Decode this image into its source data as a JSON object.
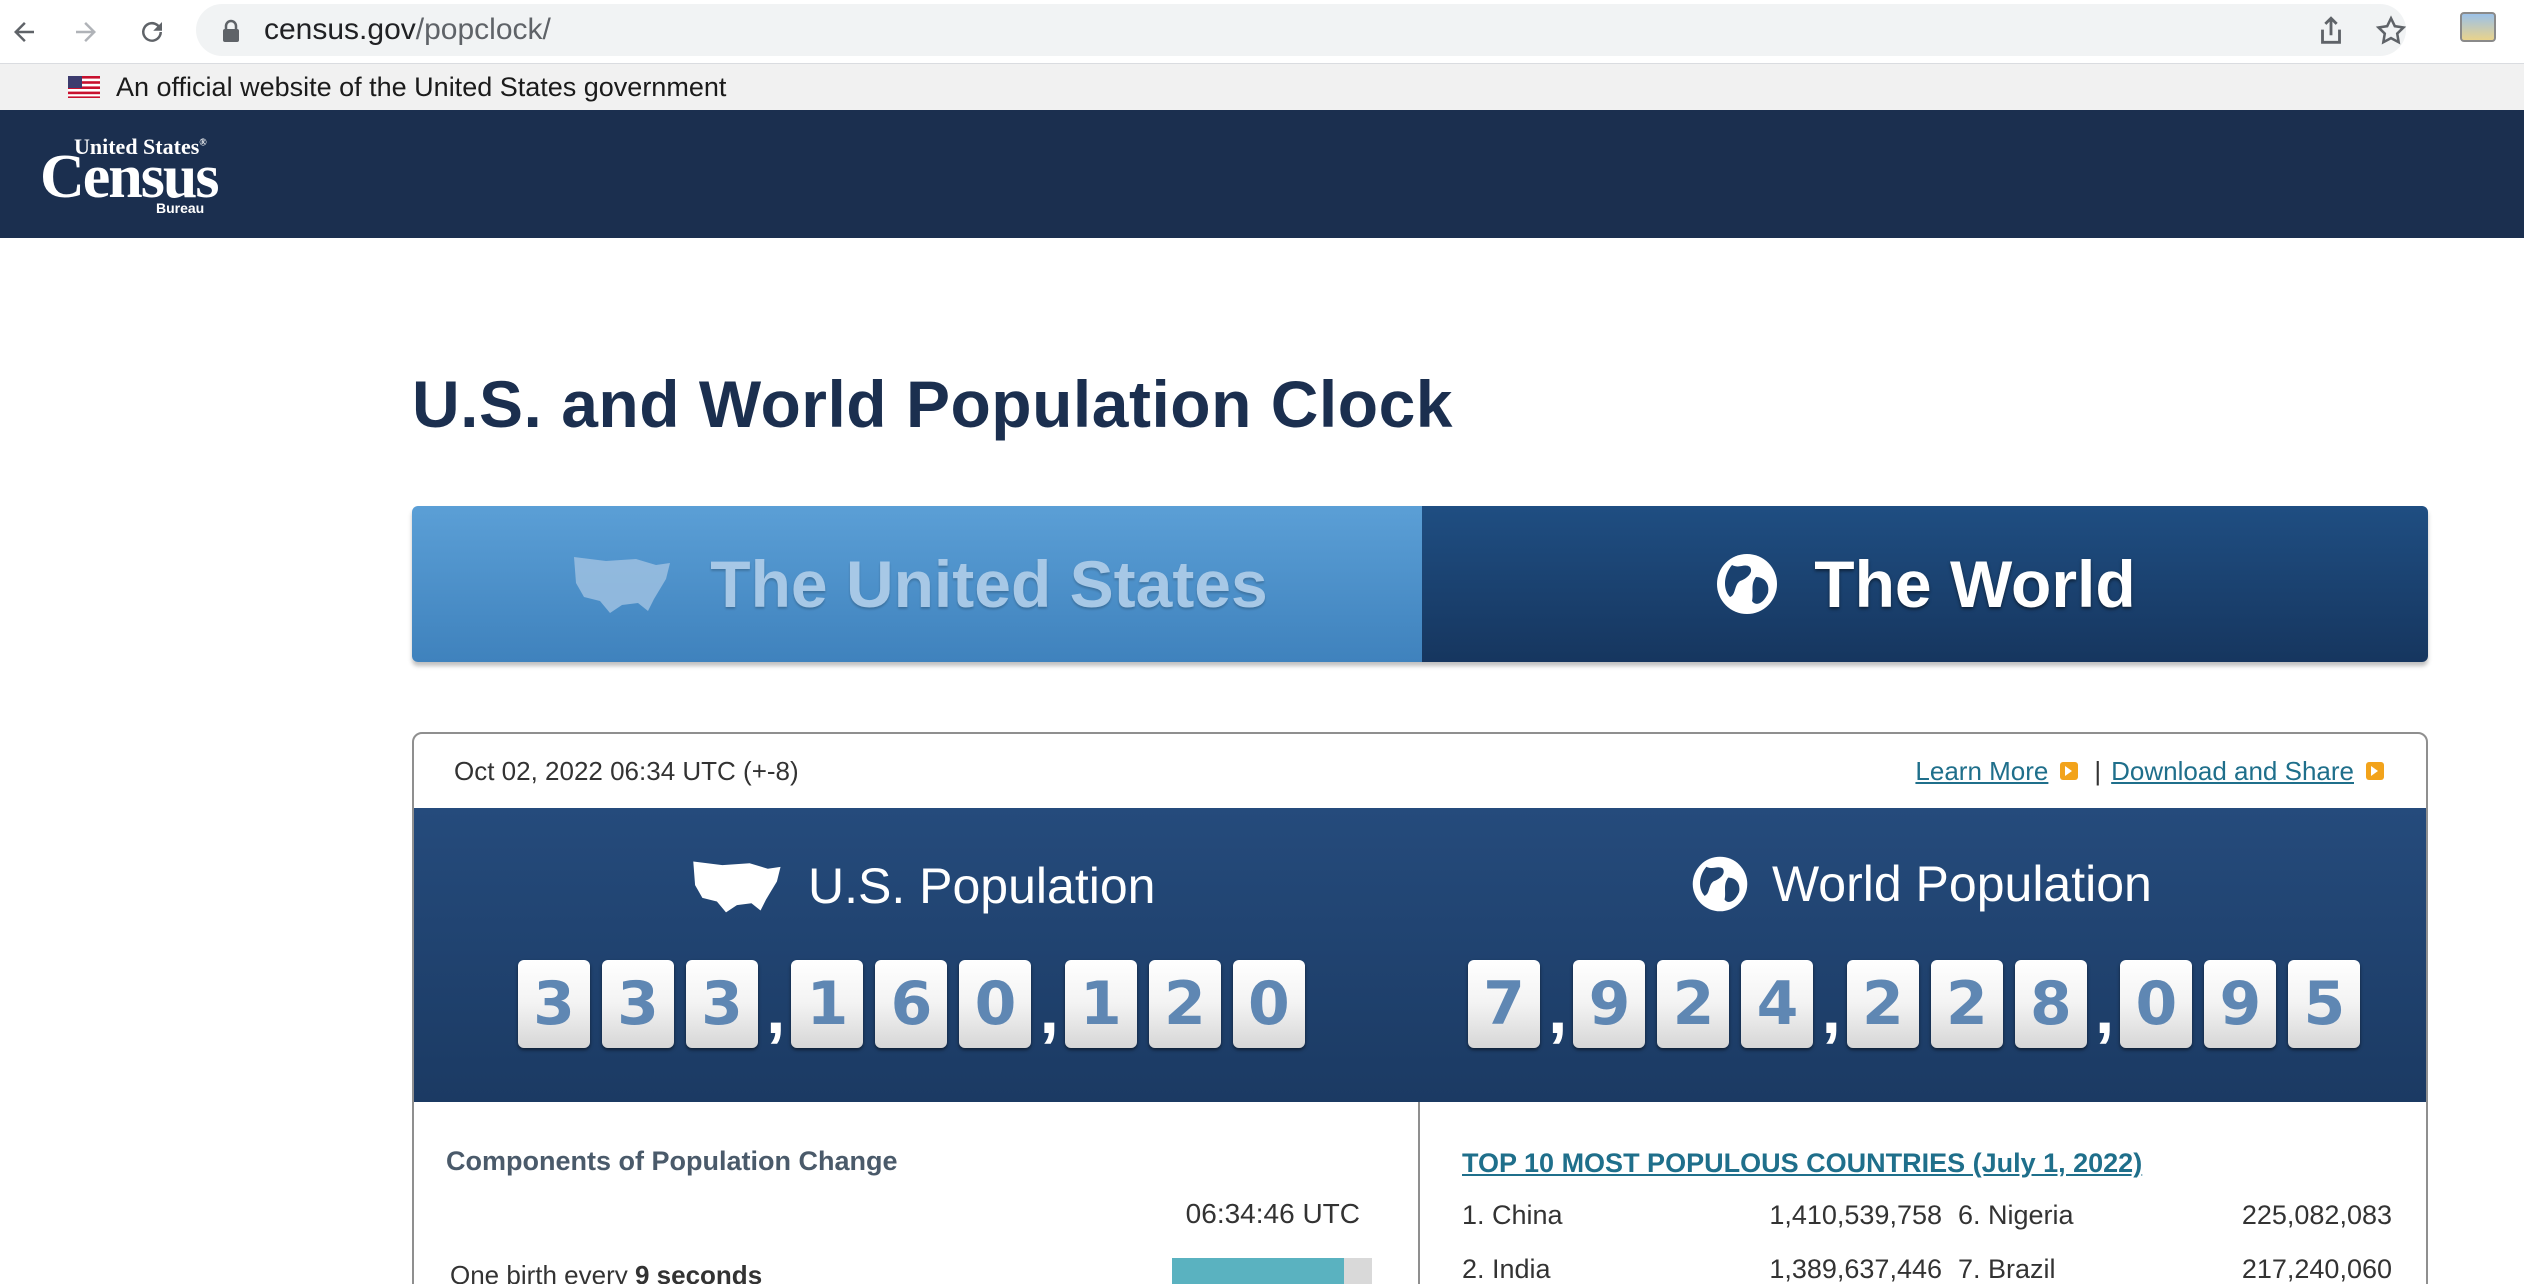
{
  "browser": {
    "url_host": "census.gov",
    "url_path": "/popclock/"
  },
  "gov_banner": {
    "text": "An official website of the United States government"
  },
  "logo": {
    "line1": "United States",
    "line2": "Census",
    "line3": "Bureau"
  },
  "page": {
    "title": "U.S. and World Population Clock"
  },
  "tabs": [
    {
      "label": "The United States",
      "active": false
    },
    {
      "label": "The World",
      "active": true
    }
  ],
  "panel": {
    "timestamp": "Oct 02, 2022 06:34 UTC (+-8)",
    "learn_more": "Learn More",
    "separator": "|",
    "download_share": "Download and Share"
  },
  "us_population": {
    "label": "U.S. Population",
    "digit_groups": [
      [
        "3",
        "3",
        "3"
      ],
      [
        "1",
        "6",
        "0"
      ],
      [
        "1",
        "2",
        "0"
      ]
    ],
    "value": "333,160,120"
  },
  "world_population": {
    "label": "World Population",
    "digit_groups": [
      [
        "7"
      ],
      [
        "9",
        "2",
        "4"
      ],
      [
        "2",
        "2",
        "8"
      ],
      [
        "0",
        "9",
        "5"
      ]
    ],
    "value": "7,924,228,095"
  },
  "components": {
    "title": "Components of Population Change",
    "time": "06:34:46 UTC",
    "birth_prefix": "One birth every ",
    "birth_seconds": "9 seconds",
    "birth_progress": 0.86
  },
  "top10": {
    "title": "TOP 10 MOST POPULOUS COUNTRIES (July 1, 2022)",
    "rows": [
      {
        "left_country": "1. China",
        "left_value": "1,410,539,758",
        "right_country": "6. Nigeria",
        "right_value": "225,082,083"
      },
      {
        "left_country": "2. India",
        "left_value": "1,389,637,446",
        "right_country": "7. Brazil",
        "right_value": "217,240,060"
      }
    ]
  },
  "colors": {
    "header_navy": "#1b2f4f",
    "tab_us": "#4a8fca",
    "tab_world": "#1a416f",
    "counter_band": "#214470",
    "link_teal": "#1f6f8b",
    "accent_orange": "#f2a31b",
    "bar_teal": "#5ab2c0"
  },
  "icons": [
    "back-arrow-icon",
    "forward-arrow-icon",
    "reload-icon",
    "lock-icon",
    "share-icon",
    "star-icon",
    "extension-icon",
    "us-flag-icon",
    "us-map-icon",
    "globe-icon",
    "arrow-box-icon"
  ]
}
